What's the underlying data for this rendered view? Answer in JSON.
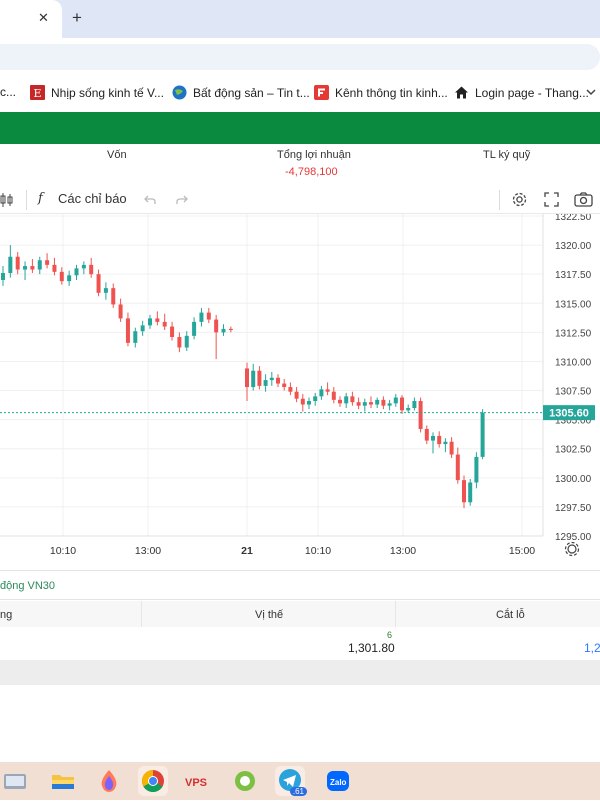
{
  "browser": {
    "tab_close_glyph": "✕",
    "tab_new_glyph": "+",
    "bookmarks": [
      {
        "label": "c...",
        "icon": "globe-icon"
      },
      {
        "label": "Nhịp sống kinh tế V...",
        "icon": "news-icon"
      },
      {
        "label": "Bất động sản – Tin t...",
        "icon": "globe-icon"
      },
      {
        "label": "Kênh thông tin kinh...",
        "icon": "news-icon"
      },
      {
        "label": "Login page - Thang...",
        "icon": "home-icon"
      }
    ]
  },
  "summary": {
    "von_label": "Vốn",
    "profit_label": "Tổng lợi nhuận",
    "profit_value": "-4,798,100",
    "margin_label": "TL ký quỹ"
  },
  "chart_toolbar": {
    "indicators_label": "Các chỉ báo",
    "fx_glyph": "f"
  },
  "chart_data": {
    "type": "candlestick",
    "x_tick_labels": [
      "10:10",
      "13:00",
      "21",
      "10:10",
      "13:00",
      "15:00"
    ],
    "y_tick_labels": [
      "1322.50",
      "1320.00",
      "1317.50",
      "1315.00",
      "1312.50",
      "1310.00",
      "1307.50",
      "1305.00",
      "1302.50",
      "1300.00",
      "1297.50",
      "1295.00"
    ],
    "ylim": [
      1295.0,
      1322.5
    ],
    "last_price": "1305.60",
    "last_price_value": 1305.6,
    "up_color": "#26a69a",
    "down_color": "#ef5350",
    "candles": [
      [
        1317.0,
        1318.2,
        1316.5,
        1317.6
      ],
      [
        1317.6,
        1320.0,
        1317.2,
        1319.0
      ],
      [
        1319.0,
        1319.4,
        1317.5,
        1317.9
      ],
      [
        1317.9,
        1318.6,
        1317.0,
        1318.2
      ],
      [
        1318.2,
        1318.8,
        1317.6,
        1317.9
      ],
      [
        1317.9,
        1319.0,
        1317.5,
        1318.7
      ],
      [
        1318.7,
        1319.3,
        1318.0,
        1318.3
      ],
      [
        1318.3,
        1318.9,
        1317.4,
        1317.7
      ],
      [
        1317.7,
        1318.1,
        1316.6,
        1316.9
      ],
      [
        1316.9,
        1317.8,
        1316.5,
        1317.4
      ],
      [
        1317.4,
        1318.3,
        1317.0,
        1318.0
      ],
      [
        1318.0,
        1318.6,
        1317.5,
        1318.3
      ],
      [
        1318.3,
        1318.9,
        1317.2,
        1317.5
      ],
      [
        1317.5,
        1317.9,
        1315.6,
        1315.9
      ],
      [
        1315.9,
        1316.8,
        1315.3,
        1316.3
      ],
      [
        1316.3,
        1316.7,
        1314.6,
        1314.9
      ],
      [
        1314.9,
        1315.4,
        1313.4,
        1313.7
      ],
      [
        1313.7,
        1314.2,
        1311.3,
        1311.6
      ],
      [
        1311.6,
        1312.9,
        1311.2,
        1312.6
      ],
      [
        1312.6,
        1313.5,
        1312.2,
        1313.1
      ],
      [
        1313.1,
        1314.0,
        1312.8,
        1313.7
      ],
      [
        1313.7,
        1314.3,
        1313.1,
        1313.4
      ],
      [
        1313.4,
        1314.1,
        1312.7,
        1313.0
      ],
      [
        1313.0,
        1313.4,
        1311.8,
        1312.1
      ],
      [
        1312.1,
        1312.5,
        1310.8,
        1311.2
      ],
      [
        1311.2,
        1312.6,
        1310.9,
        1312.2
      ],
      [
        1312.2,
        1313.8,
        1311.9,
        1313.4
      ],
      [
        1313.4,
        1314.6,
        1313.0,
        1314.2
      ],
      [
        1314.2,
        1314.6,
        1313.3,
        1313.6
      ],
      [
        1313.6,
        1314.0,
        1310.2,
        1312.5
      ],
      [
        1312.5,
        1313.2,
        1312.2,
        1312.8
      ],
      [
        1312.8,
        1313.0,
        1312.5,
        1312.7
      ],
      [
        1309.4,
        1309.9,
        1306.6,
        1307.8
      ],
      [
        1307.8,
        1309.8,
        1307.5,
        1309.2
      ],
      [
        1309.2,
        1309.6,
        1307.6,
        1307.9
      ],
      [
        1307.9,
        1308.9,
        1307.4,
        1308.4
      ],
      [
        1308.4,
        1309.1,
        1307.9,
        1308.6
      ],
      [
        1308.6,
        1308.9,
        1307.8,
        1308.1
      ],
      [
        1308.1,
        1308.5,
        1307.5,
        1307.8
      ],
      [
        1307.8,
        1308.2,
        1307.1,
        1307.4
      ],
      [
        1307.4,
        1307.8,
        1306.5,
        1306.8
      ],
      [
        1306.8,
        1307.2,
        1305.7,
        1306.3
      ],
      [
        1306.3,
        1306.9,
        1305.9,
        1306.6
      ],
      [
        1306.6,
        1307.3,
        1306.2,
        1307.0
      ],
      [
        1307.0,
        1307.9,
        1306.7,
        1307.6
      ],
      [
        1307.6,
        1308.2,
        1307.1,
        1307.4
      ],
      [
        1307.4,
        1307.8,
        1306.4,
        1306.7
      ],
      [
        1306.7,
        1307.0,
        1306.1,
        1306.4
      ],
      [
        1306.4,
        1307.3,
        1306.0,
        1307.0
      ],
      [
        1307.0,
        1307.4,
        1306.2,
        1306.5
      ],
      [
        1306.5,
        1306.9,
        1305.9,
        1306.2
      ],
      [
        1306.2,
        1306.8,
        1305.7,
        1306.5
      ],
      [
        1306.5,
        1307.0,
        1306.0,
        1306.3
      ],
      [
        1306.3,
        1306.9,
        1306.0,
        1306.7
      ],
      [
        1306.7,
        1307.0,
        1305.9,
        1306.2
      ],
      [
        1306.2,
        1306.7,
        1305.8,
        1306.4
      ],
      [
        1306.4,
        1307.2,
        1306.1,
        1306.9
      ],
      [
        1306.9,
        1307.1,
        1305.5,
        1305.8
      ],
      [
        1305.8,
        1306.3,
        1305.6,
        1306.0
      ],
      [
        1306.0,
        1306.9,
        1305.8,
        1306.6
      ],
      [
        1306.6,
        1306.9,
        1303.9,
        1304.2
      ],
      [
        1304.2,
        1304.5,
        1302.9,
        1303.2
      ],
      [
        1303.2,
        1303.9,
        1302.1,
        1303.6
      ],
      [
        1303.6,
        1304.0,
        1302.6,
        1302.9
      ],
      [
        1302.9,
        1303.4,
        1302.2,
        1303.1
      ],
      [
        1303.1,
        1303.5,
        1301.7,
        1302.0
      ],
      [
        1302.0,
        1302.6,
        1299.5,
        1299.8
      ],
      [
        1299.8,
        1300.2,
        1297.4,
        1297.9
      ],
      [
        1297.9,
        1299.9,
        1297.6,
        1299.6
      ],
      [
        1299.6,
        1302.2,
        1299.1,
        1301.8
      ],
      [
        1301.8,
        1305.9,
        1301.6,
        1305.6
      ]
    ]
  },
  "section": {
    "title": "động VN30"
  },
  "positions": {
    "col_left": "ng",
    "col_position": "Vị thế",
    "col_stop": "Cắt lỗ",
    "row": {
      "qty": "6",
      "price": "1,301.80",
      "stop": "1,2"
    }
  }
}
